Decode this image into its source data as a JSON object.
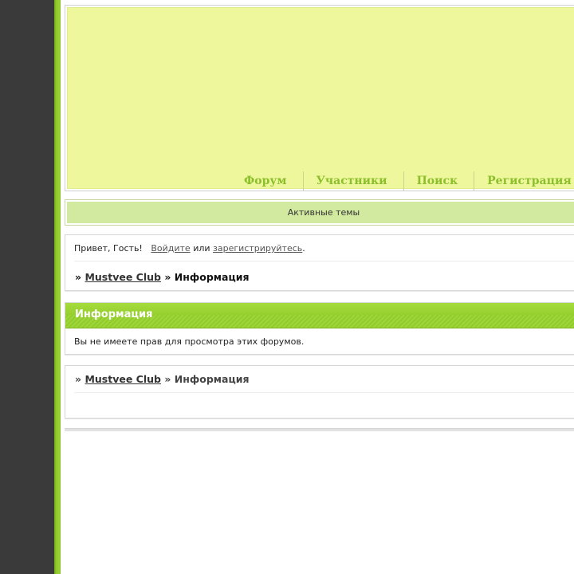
{
  "nav": {
    "items": [
      "Форум",
      "Участники",
      "Поиск",
      "Регистрация"
    ]
  },
  "active_topics": "Активные темы",
  "welcome": {
    "greeting": "Привет, Гость!",
    "login_link": "Войдите",
    "or_text": "или",
    "register_link": "зарегистрируйтесь",
    "period": "."
  },
  "breadcrumb": {
    "prefix": "»",
    "home": "Mustvee Club",
    "separator": "»",
    "current": "Информация"
  },
  "info": {
    "title": "Информация",
    "message": "Вы не имеете прав для просмотра этих форумов."
  },
  "colors": {
    "accent": "#8cbf2c",
    "header_bg": "#eef79c",
    "bar_bg": "#d2eaa0"
  }
}
